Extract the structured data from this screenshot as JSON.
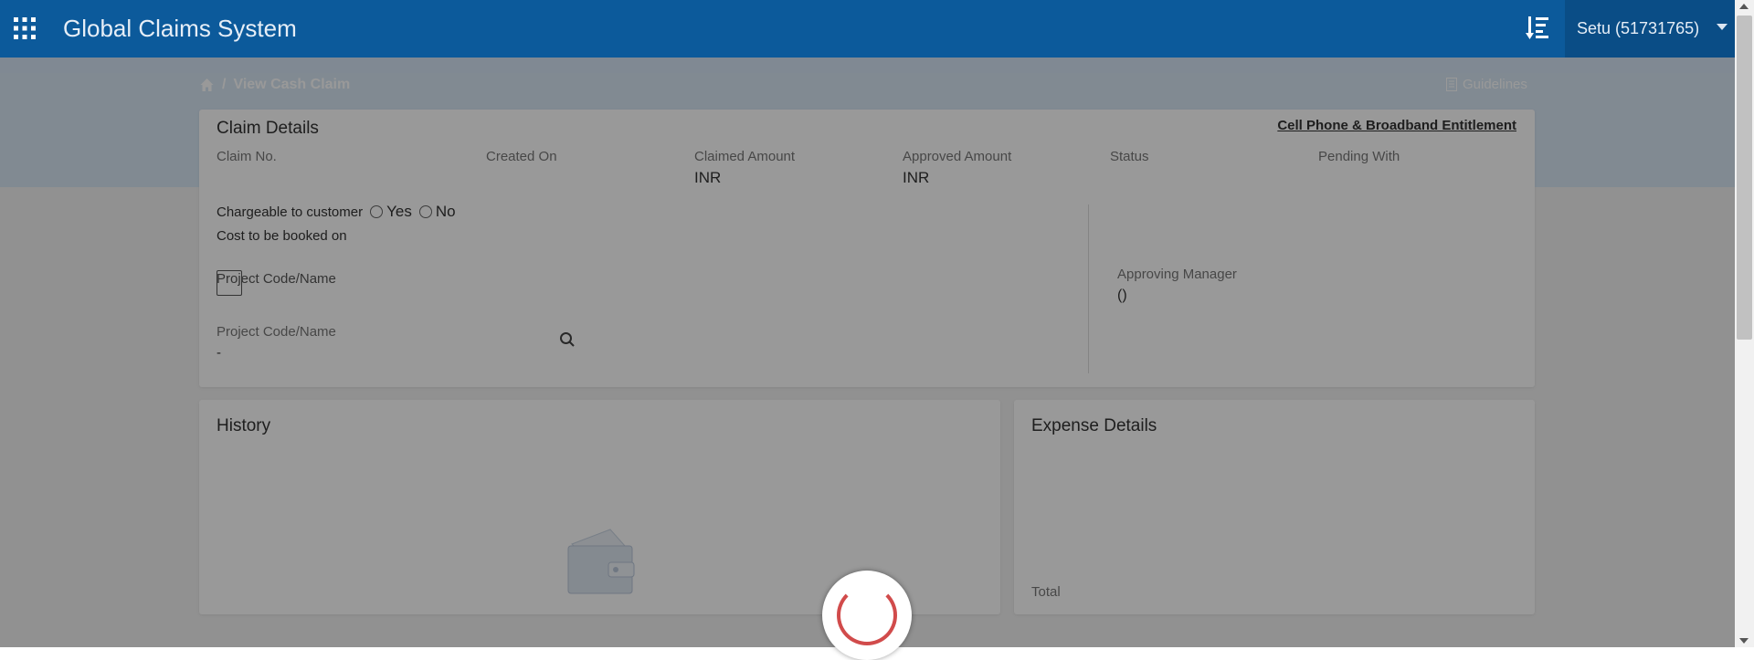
{
  "header": {
    "app_title": "Global Claims System",
    "user": "Setu (51731765)",
    "icons": [
      "apps-grid-icon",
      "sort-list-icon",
      "chevron-down-icon"
    ]
  },
  "breadcrumb": {
    "current": "View Cash Claim"
  },
  "guidelines_label": "Guidelines",
  "claim_details": {
    "title": "Claim Details",
    "entitlement_link": "Cell Phone & Broadband Entitlement",
    "fields": {
      "claim_no": {
        "label": "Claim No.",
        "value": ""
      },
      "created_on": {
        "label": "Created On",
        "value": ""
      },
      "claimed_amount": {
        "label": "Claimed Amount",
        "value": "INR"
      },
      "approved_amount": {
        "label": "Approved Amount",
        "value": "INR"
      },
      "status": {
        "label": "Status",
        "value": ""
      },
      "pending_with": {
        "label": "Pending With",
        "value": ""
      }
    },
    "chargeable": {
      "label": "Chargeable to customer",
      "yes": "Yes",
      "no": "No"
    },
    "cost_booked_label": "Cost to be booked on",
    "project_checkbox_label": "Project Code/Name",
    "project_field": {
      "label": "Project Code/Name",
      "value": "-"
    },
    "approving_manager": {
      "label": "Approving Manager",
      "value": "()"
    }
  },
  "history": {
    "title": "History"
  },
  "expense_details": {
    "title": "Expense Details",
    "total_label": "Total"
  },
  "colors": {
    "header": "#0c5a9b",
    "user_menu": "#0a4d86",
    "spinner": "#d14b4b"
  }
}
